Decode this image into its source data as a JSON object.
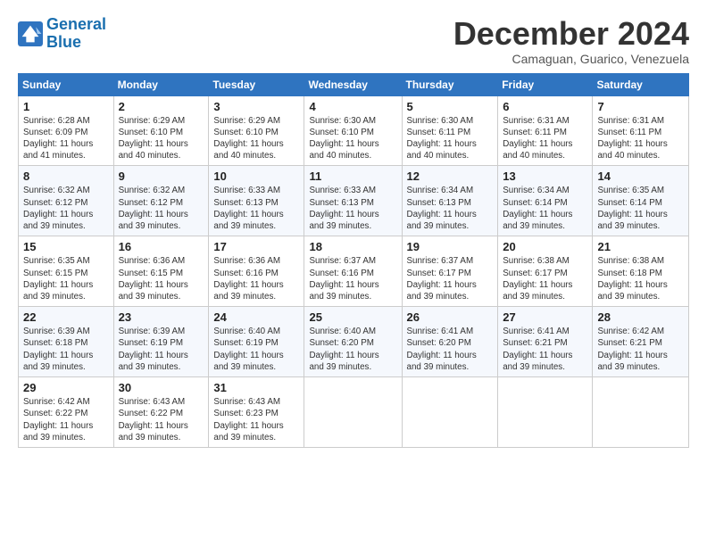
{
  "logo": {
    "line1": "General",
    "line2": "Blue"
  },
  "title": "December 2024",
  "subtitle": "Camaguan, Guarico, Venezuela",
  "header": {
    "days": [
      "Sunday",
      "Monday",
      "Tuesday",
      "Wednesday",
      "Thursday",
      "Friday",
      "Saturday"
    ]
  },
  "weeks": [
    [
      {
        "day": "1",
        "info": "Sunrise: 6:28 AM\nSunset: 6:09 PM\nDaylight: 11 hours\nand 41 minutes."
      },
      {
        "day": "2",
        "info": "Sunrise: 6:29 AM\nSunset: 6:10 PM\nDaylight: 11 hours\nand 40 minutes."
      },
      {
        "day": "3",
        "info": "Sunrise: 6:29 AM\nSunset: 6:10 PM\nDaylight: 11 hours\nand 40 minutes."
      },
      {
        "day": "4",
        "info": "Sunrise: 6:30 AM\nSunset: 6:10 PM\nDaylight: 11 hours\nand 40 minutes."
      },
      {
        "day": "5",
        "info": "Sunrise: 6:30 AM\nSunset: 6:11 PM\nDaylight: 11 hours\nand 40 minutes."
      },
      {
        "day": "6",
        "info": "Sunrise: 6:31 AM\nSunset: 6:11 PM\nDaylight: 11 hours\nand 40 minutes."
      },
      {
        "day": "7",
        "info": "Sunrise: 6:31 AM\nSunset: 6:11 PM\nDaylight: 11 hours\nand 40 minutes."
      }
    ],
    [
      {
        "day": "8",
        "info": "Sunrise: 6:32 AM\nSunset: 6:12 PM\nDaylight: 11 hours\nand 39 minutes."
      },
      {
        "day": "9",
        "info": "Sunrise: 6:32 AM\nSunset: 6:12 PM\nDaylight: 11 hours\nand 39 minutes."
      },
      {
        "day": "10",
        "info": "Sunrise: 6:33 AM\nSunset: 6:13 PM\nDaylight: 11 hours\nand 39 minutes."
      },
      {
        "day": "11",
        "info": "Sunrise: 6:33 AM\nSunset: 6:13 PM\nDaylight: 11 hours\nand 39 minutes."
      },
      {
        "day": "12",
        "info": "Sunrise: 6:34 AM\nSunset: 6:13 PM\nDaylight: 11 hours\nand 39 minutes."
      },
      {
        "day": "13",
        "info": "Sunrise: 6:34 AM\nSunset: 6:14 PM\nDaylight: 11 hours\nand 39 minutes."
      },
      {
        "day": "14",
        "info": "Sunrise: 6:35 AM\nSunset: 6:14 PM\nDaylight: 11 hours\nand 39 minutes."
      }
    ],
    [
      {
        "day": "15",
        "info": "Sunrise: 6:35 AM\nSunset: 6:15 PM\nDaylight: 11 hours\nand 39 minutes."
      },
      {
        "day": "16",
        "info": "Sunrise: 6:36 AM\nSunset: 6:15 PM\nDaylight: 11 hours\nand 39 minutes."
      },
      {
        "day": "17",
        "info": "Sunrise: 6:36 AM\nSunset: 6:16 PM\nDaylight: 11 hours\nand 39 minutes."
      },
      {
        "day": "18",
        "info": "Sunrise: 6:37 AM\nSunset: 6:16 PM\nDaylight: 11 hours\nand 39 minutes."
      },
      {
        "day": "19",
        "info": "Sunrise: 6:37 AM\nSunset: 6:17 PM\nDaylight: 11 hours\nand 39 minutes."
      },
      {
        "day": "20",
        "info": "Sunrise: 6:38 AM\nSunset: 6:17 PM\nDaylight: 11 hours\nand 39 minutes."
      },
      {
        "day": "21",
        "info": "Sunrise: 6:38 AM\nSunset: 6:18 PM\nDaylight: 11 hours\nand 39 minutes."
      }
    ],
    [
      {
        "day": "22",
        "info": "Sunrise: 6:39 AM\nSunset: 6:18 PM\nDaylight: 11 hours\nand 39 minutes."
      },
      {
        "day": "23",
        "info": "Sunrise: 6:39 AM\nSunset: 6:19 PM\nDaylight: 11 hours\nand 39 minutes."
      },
      {
        "day": "24",
        "info": "Sunrise: 6:40 AM\nSunset: 6:19 PM\nDaylight: 11 hours\nand 39 minutes."
      },
      {
        "day": "25",
        "info": "Sunrise: 6:40 AM\nSunset: 6:20 PM\nDaylight: 11 hours\nand 39 minutes."
      },
      {
        "day": "26",
        "info": "Sunrise: 6:41 AM\nSunset: 6:20 PM\nDaylight: 11 hours\nand 39 minutes."
      },
      {
        "day": "27",
        "info": "Sunrise: 6:41 AM\nSunset: 6:21 PM\nDaylight: 11 hours\nand 39 minutes."
      },
      {
        "day": "28",
        "info": "Sunrise: 6:42 AM\nSunset: 6:21 PM\nDaylight: 11 hours\nand 39 minutes."
      }
    ],
    [
      {
        "day": "29",
        "info": "Sunrise: 6:42 AM\nSunset: 6:22 PM\nDaylight: 11 hours\nand 39 minutes."
      },
      {
        "day": "30",
        "info": "Sunrise: 6:43 AM\nSunset: 6:22 PM\nDaylight: 11 hours\nand 39 minutes."
      },
      {
        "day": "31",
        "info": "Sunrise: 6:43 AM\nSunset: 6:23 PM\nDaylight: 11 hours\nand 39 minutes."
      },
      {
        "day": "",
        "info": ""
      },
      {
        "day": "",
        "info": ""
      },
      {
        "day": "",
        "info": ""
      },
      {
        "day": "",
        "info": ""
      }
    ]
  ]
}
